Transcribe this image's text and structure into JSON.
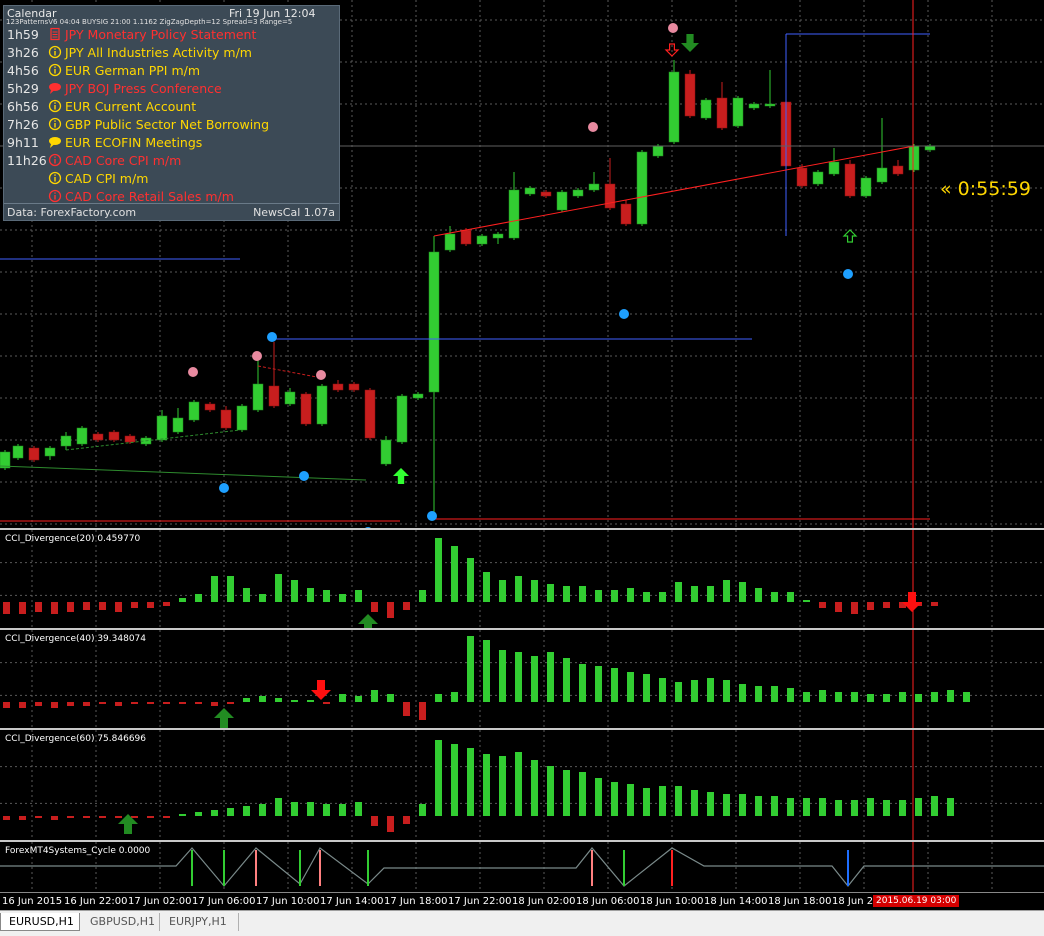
{
  "calendar": {
    "title": "Calendar",
    "datetime": "Fri 19 Jun 12:04",
    "indicator_line": "123PatternsV6 04:04  BUYSIG  21:00  1.1162  ZigZagDepth=12  Spread=3  Range=5",
    "events": [
      {
        "time": "1h59",
        "icon": "document-icon",
        "text": "JPY  Monetary Policy Statement",
        "color": "#ff3030"
      },
      {
        "time": "3h26",
        "icon": "info-icon",
        "text": "JPY  All Industries Activity m/m",
        "color": "#ffd700"
      },
      {
        "time": "4h56",
        "icon": "info-icon",
        "text": "EUR  German PPI m/m",
        "color": "#ffd700"
      },
      {
        "time": "5h29",
        "icon": "speech-icon",
        "text": "JPY  BOJ Press Conference",
        "color": "#ff3030"
      },
      {
        "time": "6h56",
        "icon": "info-icon",
        "text": "EUR  Current Account",
        "color": "#ffd700"
      },
      {
        "time": "7h26",
        "icon": "info-icon",
        "text": "GBP  Public Sector Net Borrowing",
        "color": "#ffd700"
      },
      {
        "time": "9h11",
        "icon": "speech-icon",
        "text": "EUR  ECOFIN Meetings",
        "color": "#ffd700"
      },
      {
        "time": "11h26",
        "icon": "info-icon",
        "text": "CAD  Core CPI m/m",
        "color": "#ff3030"
      },
      {
        "time": "",
        "icon": "info-icon",
        "text": "CAD  CPI m/m",
        "color": "#ffd700"
      },
      {
        "time": "",
        "icon": "info-icon",
        "text": "CAD  Core Retail Sales m/m",
        "color": "#ff3030"
      }
    ],
    "source": "Data: ForexFactory.com",
    "version": "NewsCal 1.07a"
  },
  "timer": "« 0:55:59",
  "indicators": [
    {
      "label": "CCI_Divergence(20) 0.459770"
    },
    {
      "label": "CCI_Divergence(40) 39.348074"
    },
    {
      "label": "CCI_Divergence(60) 75.846696"
    },
    {
      "label": "ForexMT4Systems_Cycle 0.0000"
    }
  ],
  "xaxis": {
    "labels": [
      "16 Jun 2015",
      "16 Jun 22:00",
      "17 Jun 02:00",
      "17 Jun 06:00",
      "17 Jun 10:00",
      "17 Jun 14:00",
      "17 Jun 18:00",
      "17 Jun 22:00",
      "18 Jun 02:00",
      "18 Jun 06:00",
      "18 Jun 10:00",
      "18 Jun 14:00",
      "18 Jun 18:00",
      "18 Jun 22"
    ],
    "current": "2015.06.19 03:00"
  },
  "tabs": [
    {
      "label": "EURUSD,H1",
      "active": true
    },
    {
      "label": "GBPUSD,H1",
      "active": false
    },
    {
      "label": "EURJPY,H1",
      "active": false
    }
  ],
  "colors": {
    "bull": "#32cd32",
    "bear": "#c81e1e",
    "grid": "#5a5a5a",
    "level_line": "#4060ff",
    "trend_line": "#ff2020",
    "current_time_line": "#ff2020"
  },
  "chart_data": {
    "type": "candlestick",
    "symbol": "EURUSD",
    "timeframe": "H1",
    "candles": [
      {
        "o": 0.4482,
        "h": 0.447,
        "l": 0.449,
        "c": 0.4478,
        "dir": "bull"
      },
      {
        "o": 0.446,
        "h": 0.444,
        "l": 0.4485,
        "c": 0.4445,
        "dir": "bull"
      },
      {
        "o": 0.446,
        "h": 0.444,
        "l": 0.447,
        "c": 0.4448,
        "dir": "bull"
      },
      {
        "o": 0.445,
        "h": 0.4445,
        "l": 0.4465,
        "c": 0.4458,
        "dir": "bear"
      },
      {
        "o": 0.4452,
        "h": 0.4445,
        "l": 0.446,
        "c": 0.4448,
        "dir": "bull"
      }
    ]
  }
}
